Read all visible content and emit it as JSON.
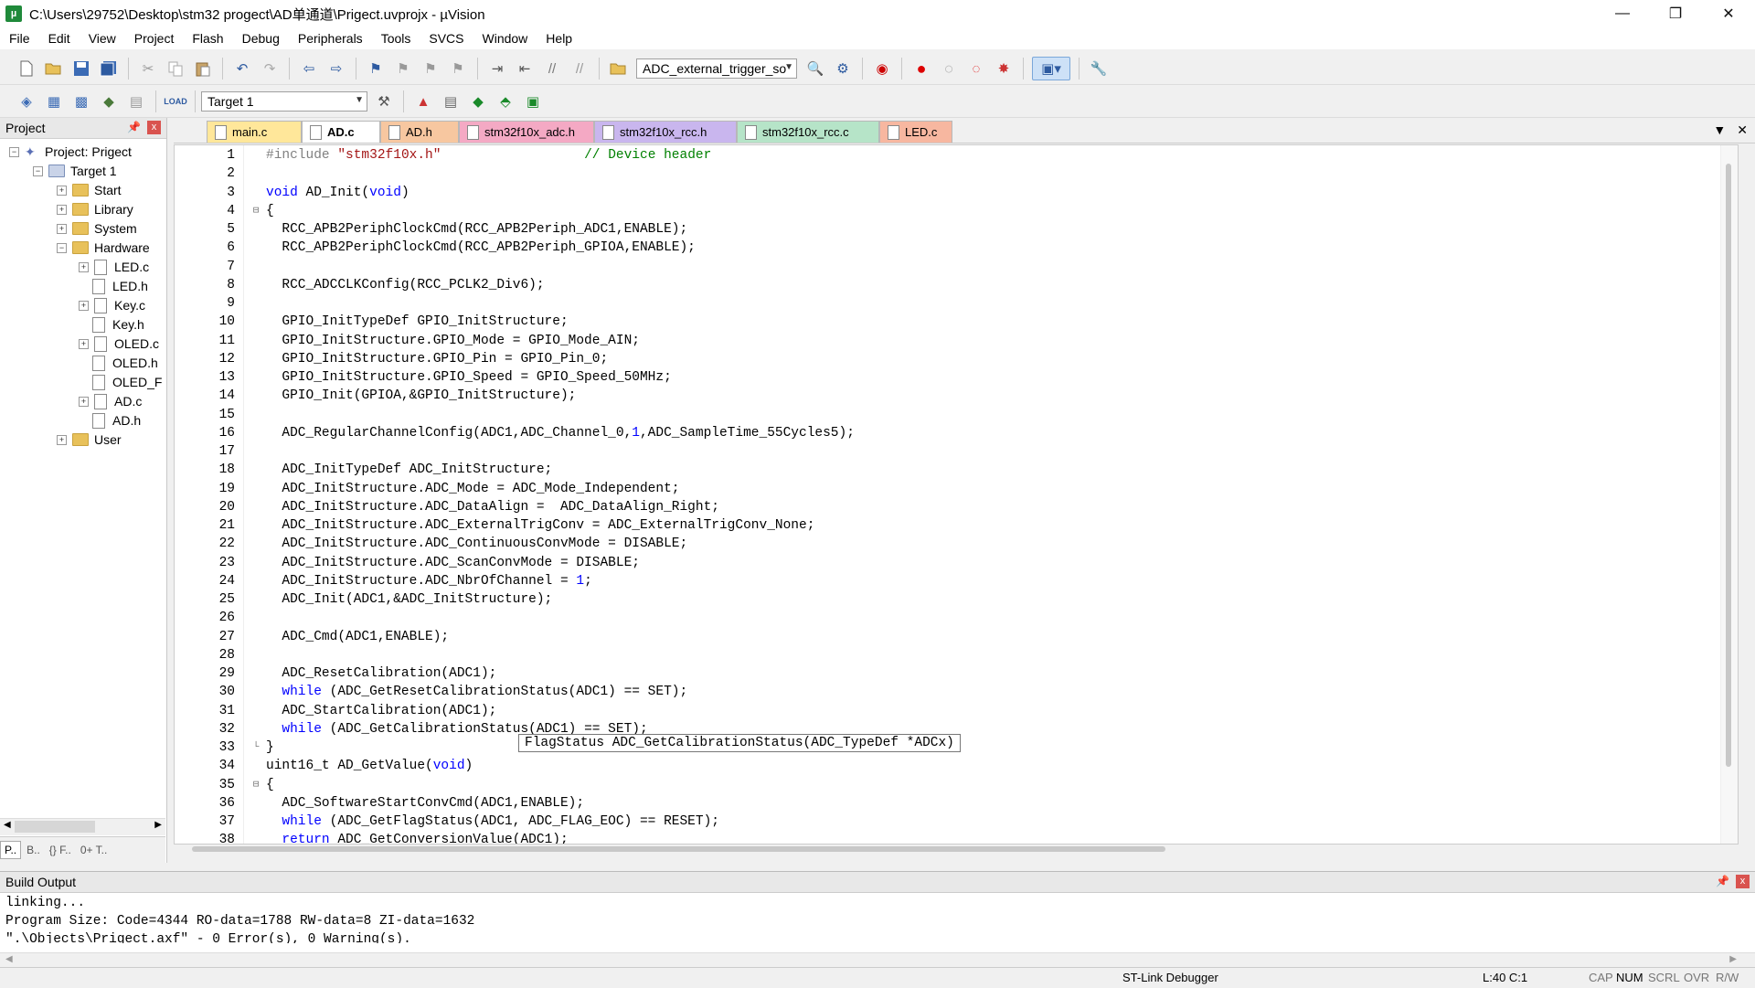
{
  "window": {
    "title": "C:\\Users\\29752\\Desktop\\stm32 progect\\AD单通道\\Prigect.uvprojx - µVision",
    "minimize": "—",
    "restore": "❐",
    "close": "✕"
  },
  "menu": [
    "File",
    "Edit",
    "View",
    "Project",
    "Flash",
    "Debug",
    "Peripherals",
    "Tools",
    "SVCS",
    "Window",
    "Help"
  ],
  "toolbar": {
    "find_combo_value": "ADC_external_trigger_so",
    "target_combo_value": "Target 1"
  },
  "project_panel": {
    "title": "Project",
    "root": "Project: Prigect",
    "target": "Target 1",
    "groups": [
      "Start",
      "Library",
      "System",
      "Hardware",
      "User"
    ],
    "hardware_files": [
      "LED.c",
      "LED.h",
      "Key.c",
      "Key.h",
      "OLED.c",
      "OLED.h",
      "OLED_F",
      "AD.c",
      "AD.h"
    ],
    "bottom_tabs": [
      "P..",
      "B..",
      "{} F..",
      "0+ T.."
    ]
  },
  "editor_tabs": [
    "main.c",
    "AD.c",
    "AD.h",
    "stm32f10x_adc.h",
    "stm32f10x_rcc.h",
    "stm32f10x_rcc.c",
    "LED.c"
  ],
  "editor_tab_colors": [
    "#ffe79a",
    "#bcd8f5",
    "#f7c7a0",
    "#f4a9c4",
    "#c9b6ee",
    "#b6e4c8",
    "#f7b7a0"
  ],
  "active_tab": "AD.c",
  "code_lines": [
    "#include \"stm32f10x.h\"                  // Device header",
    "",
    "void AD_Init(void)",
    "{",
    "  RCC_APB2PeriphClockCmd(RCC_APB2Periph_ADC1,ENABLE);",
    "  RCC_APB2PeriphClockCmd(RCC_APB2Periph_GPIOA,ENABLE);",
    "",
    "  RCC_ADCCLKConfig(RCC_PCLK2_Div6);",
    "",
    "  GPIO_InitTypeDef GPIO_InitStructure;",
    "  GPIO_InitStructure.GPIO_Mode = GPIO_Mode_AIN;",
    "  GPIO_InitStructure.GPIO_Pin = GPIO_Pin_0;",
    "  GPIO_InitStructure.GPIO_Speed = GPIO_Speed_50MHz;",
    "  GPIO_Init(GPIOA,&GPIO_InitStructure);",
    "",
    "  ADC_RegularChannelConfig(ADC1,ADC_Channel_0,1,ADC_SampleTime_55Cycles5);",
    "",
    "  ADC_InitTypeDef ADC_InitStructure;",
    "  ADC_InitStructure.ADC_Mode = ADC_Mode_Independent;",
    "  ADC_InitStructure.ADC_DataAlign =  ADC_DataAlign_Right;",
    "  ADC_InitStructure.ADC_ExternalTrigConv = ADC_ExternalTrigConv_None;",
    "  ADC_InitStructure.ADC_ContinuousConvMode = DISABLE;",
    "  ADC_InitStructure.ADC_ScanConvMode = DISABLE;",
    "  ADC_InitStructure.ADC_NbrOfChannel = 1;",
    "  ADC_Init(ADC1,&ADC_InitStructure);",
    "",
    "  ADC_Cmd(ADC1,ENABLE);",
    "",
    "  ADC_ResetCalibration(ADC1);",
    "  while (ADC_GetResetCalibrationStatus(ADC1) == SET);",
    "  ADC_StartCalibration(ADC1);",
    "  while (ADC_GetCalibrationStatus(ADC1) == SET);",
    "}",
    "uint16_t AD_GetValue(void)",
    "{",
    "  ADC_SoftwareStartConvCmd(ADC1,ENABLE);",
    "  while (ADC_GetFlagStatus(ADC1, ADC_FLAG_EOC) == RESET);",
    "  return ADC_GetConversionValue(ADC1);"
  ],
  "fold_markers": {
    "4": "⊟",
    "33": "└",
    "35": "⊟"
  },
  "tooltip": "FlagStatus ADC_GetCalibrationStatus(ADC_TypeDef *ADCx)",
  "build_output": {
    "title": "Build Output",
    "lines": [
      "linking...",
      "Program Size: Code=4344 RO-data=1788 RW-data=8 ZI-data=1632",
      "\".\\Objects\\Prigect.axf\" - 0 Error(s), 0 Warning(s)."
    ]
  },
  "status_bar": {
    "debugger": "ST-Link Debugger",
    "cursor": "L:40 C:1",
    "indicators": [
      "CAP",
      "NUM",
      "SCRL",
      "OVR",
      "R/W"
    ]
  }
}
